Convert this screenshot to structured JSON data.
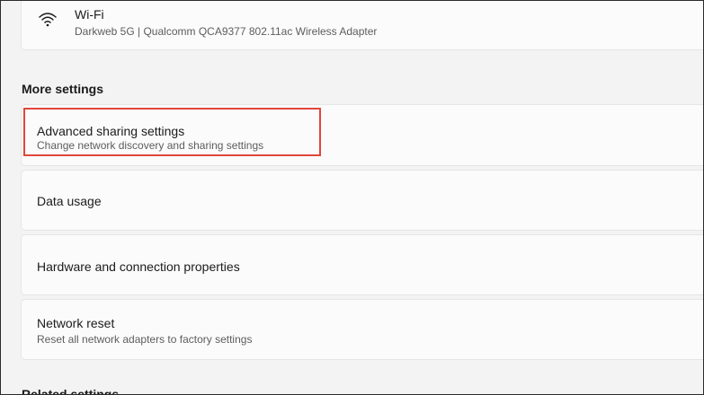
{
  "wifi": {
    "title": "Wi-Fi",
    "subtitle": "Darkweb 5G | Qualcomm QCA9377 802.11ac Wireless Adapter",
    "icon": "wifi-icon"
  },
  "more_settings": {
    "heading": "More settings",
    "items": [
      {
        "title": "Advanced sharing settings",
        "subtitle": "Change network discovery and sharing settings"
      },
      {
        "title": "Data usage"
      },
      {
        "title": "Hardware and connection properties"
      },
      {
        "title": "Network reset",
        "subtitle": "Reset all network adapters to factory settings"
      }
    ]
  },
  "related_settings": {
    "heading": "Related settings"
  },
  "colors": {
    "highlight": "#e0463a",
    "background": "#f3f3f3",
    "card": "#fbfbfb"
  }
}
